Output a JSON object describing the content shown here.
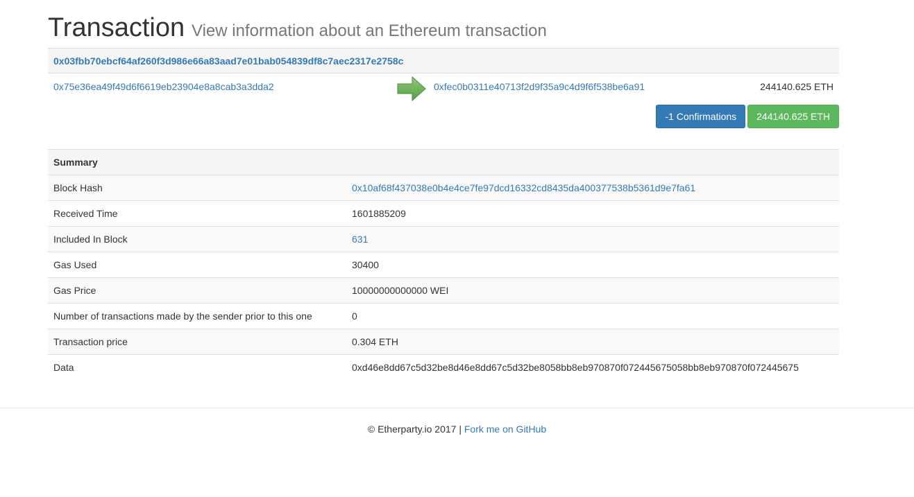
{
  "header": {
    "title": "Transaction",
    "subtitle": "View information about an Ethereum transaction"
  },
  "transaction": {
    "hash": "0x03fbb70ebcf64af260f3d986e66a83aad7e01bab054839df8c7aec2317e2758c",
    "from": "0x75e36ea49f49d6f6619eb23904e8a8cab3a3dda2",
    "to": "0xfec0b0311e40713f2d9f35a9c4d9f6f538be6a91",
    "amount": "244140.625 ETH",
    "confirmations_label": "-1 Confirmations",
    "amount_badge": "244140.625 ETH",
    "arrow_icon": "arrow-right-icon",
    "colors": {
      "arrow": "#5cb85c",
      "primary": "#337ab7",
      "success": "#5cb85c"
    }
  },
  "summary": {
    "heading": "Summary",
    "rows": [
      {
        "label": "Block Hash",
        "value": "0x10af68f437038e0b4e4ce7fe97dcd16332cd8435da400377538b5361d9e7fa61",
        "link": true
      },
      {
        "label": "Received Time",
        "value": "1601885209",
        "link": false
      },
      {
        "label": "Included In Block",
        "value": "631",
        "link": true
      },
      {
        "label": "Gas Used",
        "value": "30400",
        "link": false
      },
      {
        "label": "Gas Price",
        "value": "10000000000000 WEI",
        "link": false
      },
      {
        "label": "Number of transactions made by the sender prior to this one",
        "value": "0",
        "link": false
      },
      {
        "label": "Transaction price",
        "value": "0.304 ETH",
        "link": false
      },
      {
        "label": "Data",
        "value": "0xd46e8dd67c5d32be8d46e8dd67c5d32be8058bb8eb970870f072445675058bb8eb970870f072445675",
        "link": false
      }
    ]
  },
  "footer": {
    "copyright": "© Etherparty.io 2017 | ",
    "github_link": "Fork me on GitHub"
  }
}
